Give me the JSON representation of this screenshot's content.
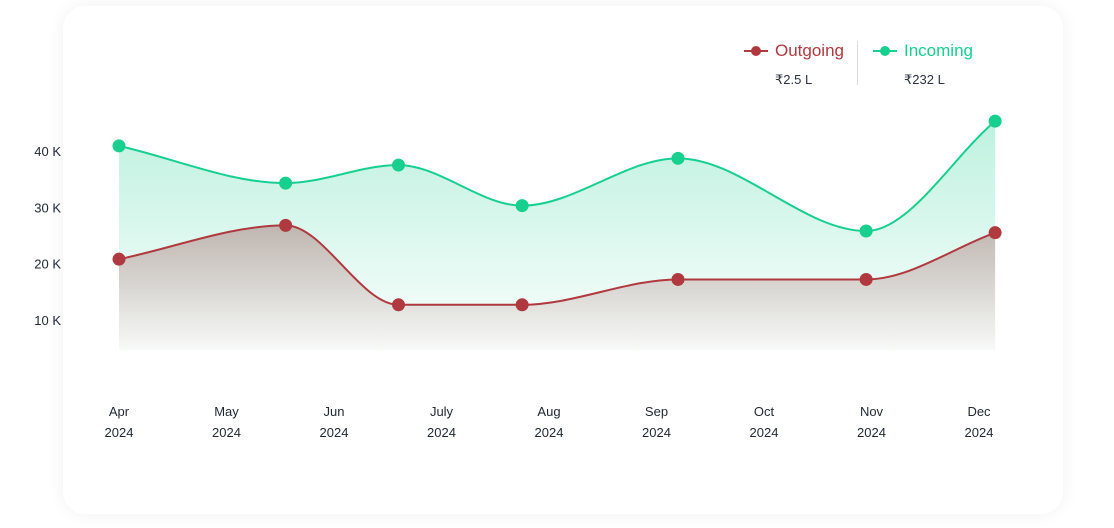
{
  "colors": {
    "outgoing": "#b0393f",
    "incoming": "#17cf8f"
  },
  "legend": {
    "outgoing": {
      "label": "Outgoing",
      "value": "₹2.5 L"
    },
    "incoming": {
      "label": "Incoming",
      "value": "₹232 L"
    }
  },
  "chart_data": {
    "type": "area",
    "x_labels": [
      [
        "Apr",
        "2024"
      ],
      [
        "May",
        "2024"
      ],
      [
        "Jun",
        "2024"
      ],
      [
        "July",
        "2024"
      ],
      [
        "Aug",
        "2024"
      ],
      [
        "Sep",
        "2024"
      ],
      [
        "Oct",
        "2024"
      ],
      [
        "Nov",
        "2024"
      ],
      [
        "Dec",
        "2024"
      ]
    ],
    "y_ticks": [
      {
        "value": 10000,
        "label": "10 K"
      },
      {
        "value": 20000,
        "label": "20 K"
      },
      {
        "value": 30000,
        "label": "30 K"
      },
      {
        "value": 40000,
        "label": "40 K"
      }
    ],
    "ylim": [
      0,
      45000
    ],
    "grid": false,
    "legend_position": "top-right",
    "series": [
      {
        "name": "Incoming",
        "color": "#17cf8f",
        "points": [
          {
            "x": 0,
            "y": 40900
          },
          {
            "x": 1.55,
            "y": 34300
          },
          {
            "x": 2.6,
            "y": 37500
          },
          {
            "x": 3.75,
            "y": 30300
          },
          {
            "x": 5.2,
            "y": 38700
          },
          {
            "x": 6.95,
            "y": 25800
          },
          {
            "x": 8.15,
            "y": 45300
          }
        ]
      },
      {
        "name": "Outgoing",
        "color": "#b0393f",
        "points": [
          {
            "x": 0,
            "y": 20800
          },
          {
            "x": 1.55,
            "y": 26800
          },
          {
            "x": 2.6,
            "y": 12700
          },
          {
            "x": 3.75,
            "y": 12700
          },
          {
            "x": 5.2,
            "y": 17200
          },
          {
            "x": 6.95,
            "y": 17200
          },
          {
            "x": 8.15,
            "y": 25500
          }
        ]
      }
    ]
  }
}
